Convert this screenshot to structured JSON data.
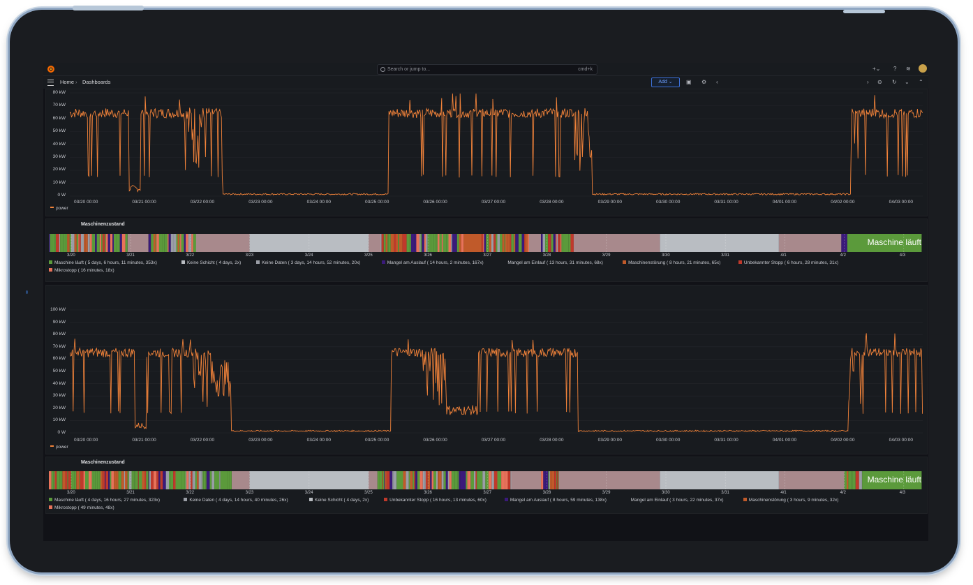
{
  "app": {
    "search_placeholder": "Search or jump to...",
    "search_shortcut": "cmd+k",
    "breadcrumb": [
      "Home",
      "Dashboards"
    ],
    "add_label": "Add"
  },
  "colors": {
    "orange": "#f2833a",
    "green": "#5b9a3b",
    "gray": "#9a9ea6",
    "lightgray": "#b9bdc2",
    "rose": "#a8898c",
    "purple": "#3a1a7a",
    "brown": "#c05a2a",
    "red": "#c0392b",
    "salmon": "#e8725a"
  },
  "power_panel_1": {
    "y_ticks": [
      "80 kW",
      "70 kW",
      "60 kW",
      "50 kW",
      "40 kW",
      "30 kW",
      "20 kW",
      "10 kW",
      "0 W"
    ],
    "x_ticks": [
      "03/20 00:00",
      "03/21 00:00",
      "03/22 00:00",
      "03/23 00:00",
      "03/24 00:00",
      "03/25 00:00",
      "03/26 00:00",
      "03/27 00:00",
      "03/28 00:00",
      "03/29 00:00",
      "03/30 00:00",
      "03/31 00:00",
      "04/01 00:00",
      "04/02 00:00",
      "04/03 00:00"
    ],
    "legend": "power"
  },
  "state_panel_1": {
    "title": "Maschinenzustand",
    "x_ticks": [
      "3/20",
      "3/21",
      "3/22",
      "3/23",
      "3/24",
      "3/25",
      "3/26",
      "3/27",
      "3/28",
      "3/29",
      "3/30",
      "3/31",
      "4/1",
      "4/2",
      "4/3"
    ],
    "current_state": "Maschine läuft",
    "legend": [
      {
        "label": "Maschine läuft ( 5 days, 6 hours, 11 minutes, 353x)",
        "color": "green"
      },
      {
        "label": "Keine Schicht ( 4 days, 2x)",
        "color": "lightgray"
      },
      {
        "label": "Keine Daten ( 3 days, 14 hours, 52 minutes, 20x)",
        "color": "gray"
      },
      {
        "label": "Mangel am Auslauf ( 14 hours, 2 minutes, 167x)",
        "color": "purple"
      },
      {
        "label": "Mangel am Einlauf ( 13 hours, 31 minutes, 68x)",
        "color": "none"
      },
      {
        "label": "Maschinenstörung ( 8 hours, 21 minutes, 65x)",
        "color": "brown"
      },
      {
        "label": "Unbekannter Stopp ( 6 hours, 28 minutes, 31x)",
        "color": "red"
      },
      {
        "label": "Mikrostopp ( 16 minutes, 18x)",
        "color": "salmon"
      }
    ]
  },
  "power_panel_2": {
    "y_ticks": [
      "100 kW",
      "90 kW",
      "80 kW",
      "70 kW",
      "60 kW",
      "50 kW",
      "40 kW",
      "30 kW",
      "20 kW",
      "10 kW",
      "0 W"
    ],
    "x_ticks": [
      "03/20 00:00",
      "03/21 00:00",
      "03/22 00:00",
      "03/23 00:00",
      "03/24 00:00",
      "03/25 00:00",
      "03/26 00:00",
      "03/27 00:00",
      "03/28 00:00",
      "03/29 00:00",
      "03/30 00:00",
      "03/31 00:00",
      "04/01 00:00",
      "04/02 00:00",
      "04/03 00:00"
    ],
    "legend": "power"
  },
  "state_panel_2": {
    "title": "Maschinenzustand",
    "x_ticks": [
      "3/20",
      "3/21",
      "3/22",
      "3/23",
      "3/24",
      "3/25",
      "3/26",
      "3/27",
      "3/28",
      "3/29",
      "3/30",
      "3/31",
      "4/1",
      "4/2",
      "4/3"
    ],
    "current_state": "Maschine läuft",
    "legend": [
      {
        "label": "Maschine läuft ( 4 days, 16 hours, 27 minutes, 323x)",
        "color": "green"
      },
      {
        "label": "Keine Daten ( 4 days, 14 hours, 40 minutes, 26x)",
        "color": "gray"
      },
      {
        "label": "Keine Schicht ( 4 days, 2x)",
        "color": "lightgray"
      },
      {
        "label": "Unbekannter Stopp ( 16 hours, 13 minutes, 60x)",
        "color": "red"
      },
      {
        "label": "Mangel am Auslauf ( 8 hours, 59 minutes, 138x)",
        "color": "purple"
      },
      {
        "label": "Mangel am Einlauf ( 3 hours, 22 minutes, 37x)",
        "color": "none"
      },
      {
        "label": "Maschinenstörung ( 3 hours, 9 minutes, 32x)",
        "color": "brown"
      },
      {
        "label": "Mikrostopp ( 49 minutes, 48x)",
        "color": "salmon"
      }
    ]
  }
}
